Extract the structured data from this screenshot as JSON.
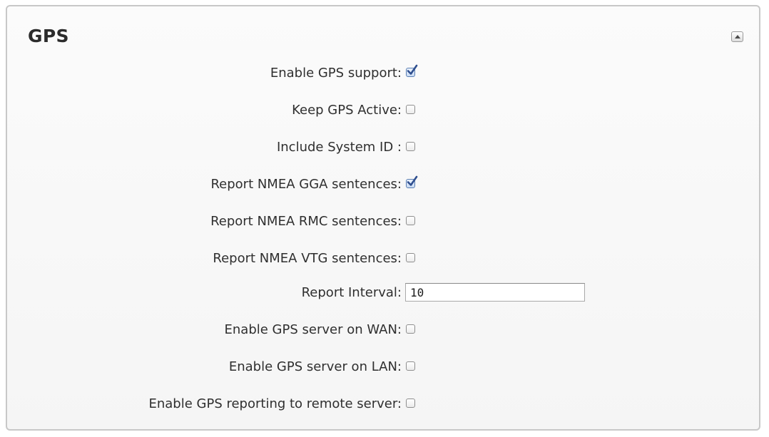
{
  "panel": {
    "title": "GPS"
  },
  "fields": [
    {
      "label": "Enable GPS support:",
      "type": "checkbox",
      "checked": true
    },
    {
      "label": "Keep GPS Active:",
      "type": "checkbox",
      "checked": false
    },
    {
      "label": "Include System ID :",
      "type": "checkbox",
      "checked": false
    },
    {
      "label": "Report NMEA GGA sentences:",
      "type": "checkbox",
      "checked": true
    },
    {
      "label": "Report NMEA RMC sentences:",
      "type": "checkbox",
      "checked": false
    },
    {
      "label": "Report NMEA VTG sentences:",
      "type": "checkbox",
      "checked": false
    },
    {
      "label": "Report Interval:",
      "type": "text",
      "value": "10"
    },
    {
      "label": "Enable GPS server on WAN:",
      "type": "checkbox",
      "checked": false
    },
    {
      "label": "Enable GPS server on LAN:",
      "type": "checkbox",
      "checked": false
    },
    {
      "label": "Enable GPS reporting to remote server:",
      "type": "checkbox",
      "checked": false
    }
  ],
  "icons": {
    "collapse": "collapse-up-icon",
    "check": "check-icon"
  },
  "colors": {
    "panel_border": "#c8c8c8",
    "checkmark": "#2f4f8f",
    "text": "#2f2f2f"
  }
}
